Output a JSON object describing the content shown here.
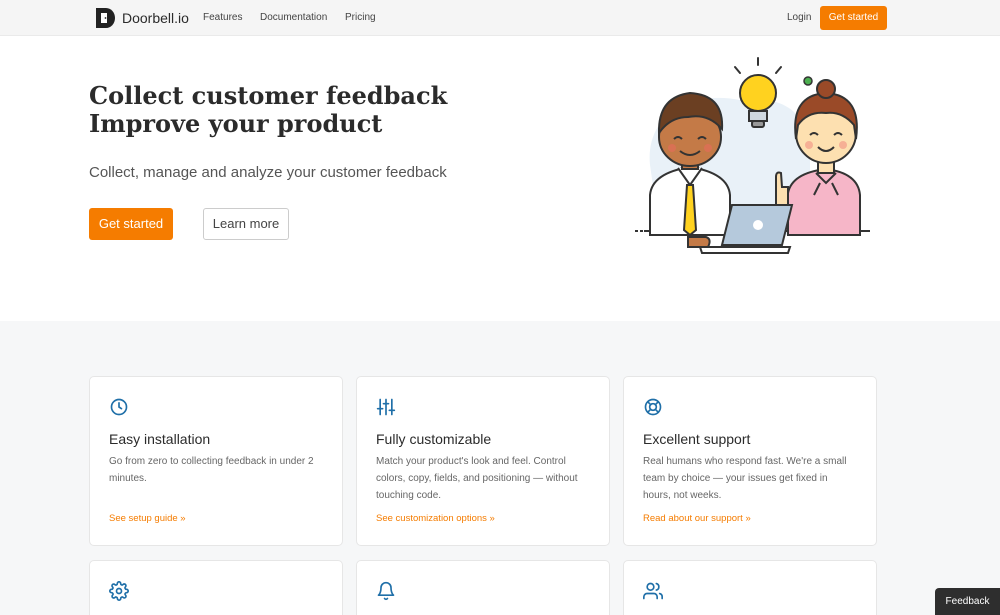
{
  "nav": {
    "logo_text": "Doorbell.io",
    "links": [
      "Features",
      "Documentation",
      "Pricing"
    ],
    "login": "Login",
    "cta": "Get started"
  },
  "hero": {
    "title_line1": "Collect customer feedback",
    "title_line2": "Improve your product",
    "subtitle": "Collect, manage and analyze your customer feedback",
    "primary_button": "Get started",
    "secondary_button": "Learn more"
  },
  "features": [
    {
      "icon": "clock-icon",
      "title": "Easy installation",
      "description": "Go from zero to collecting feedback in under 2 minutes.",
      "link": "See setup guide »"
    },
    {
      "icon": "sliders-icon",
      "title": "Fully customizable",
      "description": "Match your product's look and feel. Control colors, copy, fields, and positioning — without touching code.",
      "link": "See customization options »"
    },
    {
      "icon": "lifebuoy-icon",
      "title": "Excellent support",
      "description": "Real humans who respond fast. We're a small team by choice — your issues get fixed in hours, not weeks.",
      "link": "Read about our support »"
    },
    {
      "icon": "gear-icon"
    },
    {
      "icon": "bell-icon"
    },
    {
      "icon": "users-icon"
    }
  ],
  "feedback_tab": "Feedback",
  "colors": {
    "accent": "#f57c00",
    "icon": "#1f6fa8",
    "dark": "#2b2b2b"
  }
}
